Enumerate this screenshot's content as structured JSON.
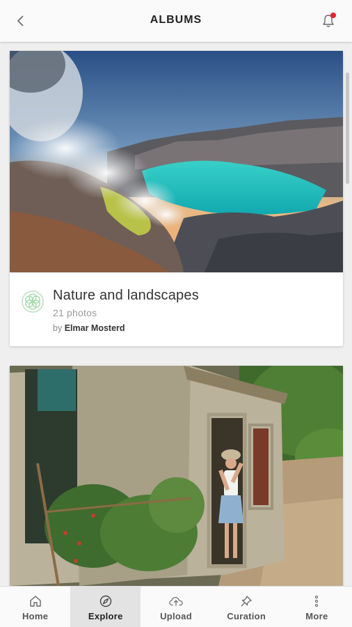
{
  "header": {
    "title": "ALBUMS",
    "has_notification": true,
    "notification_color": "#e8212e"
  },
  "albums": [
    {
      "title": "Nature and landscapes",
      "count": "21 photos",
      "by_prefix": "by",
      "author": "Elmar Mosterd",
      "image": "volcanic crater with turquoise lake and sulfur smoke"
    },
    {
      "title": "",
      "count": "",
      "by_prefix": "",
      "author": "",
      "image": "woman standing in doorway of old stone house"
    }
  ],
  "nav": {
    "items": [
      {
        "label": "Home",
        "icon": "home-icon"
      },
      {
        "label": "Explore",
        "icon": "compass-icon",
        "active": true
      },
      {
        "label": "Upload",
        "icon": "cloud-upload-icon"
      },
      {
        "label": "Curation",
        "icon": "pin-icon"
      },
      {
        "label": "More",
        "icon": "more-vertical-icon"
      }
    ]
  },
  "colors": {
    "header_bg": "#fafafa",
    "page_bg": "#efefef",
    "nav_active_bg": "#e3e3e3",
    "album_icon": "#9fd8a4"
  }
}
